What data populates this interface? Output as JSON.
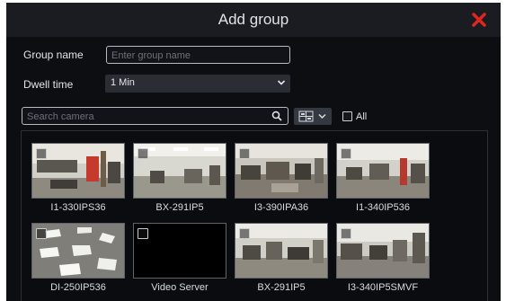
{
  "dialog": {
    "title": "Add group",
    "close_icon": "close-icon",
    "accent_color": "#e0261f"
  },
  "form": {
    "group_name_label": "Group name",
    "group_name_placeholder": "Enter group name",
    "group_name_value": "",
    "dwell_time_label": "Dwell time",
    "dwell_time_value": "1 Min"
  },
  "search": {
    "placeholder": "Search camera",
    "value": ""
  },
  "layout_button_icon": "layout-grid-icon",
  "select_all": {
    "label": "All",
    "checked": false
  },
  "cameras": [
    {
      "name": "I1-330IPS36",
      "checked": false
    },
    {
      "name": "BX-291IP5",
      "checked": false
    },
    {
      "name": "I3-390IPA36",
      "checked": false
    },
    {
      "name": "I1-340IP536",
      "checked": false
    },
    {
      "name": "DI-250IP536",
      "checked": false
    },
    {
      "name": "Video Server",
      "checked": false
    },
    {
      "name": "BX-291IP5",
      "checked": false
    },
    {
      "name": "I3-340IP5SMVF",
      "checked": false
    }
  ]
}
